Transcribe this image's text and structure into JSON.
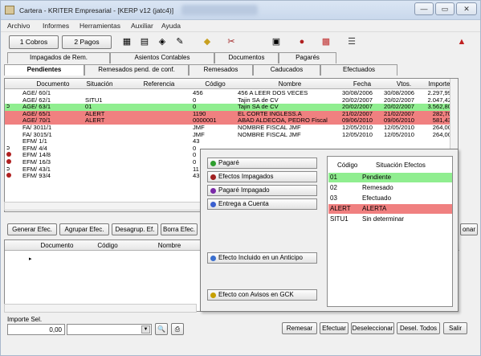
{
  "window": {
    "title": "Cartera - KRITER Empresarial - [KERP v12 (jatc4)]",
    "buttons": [
      "—",
      "▭",
      "✕"
    ]
  },
  "menu": [
    "Archivo",
    "Informes",
    "Herramientas",
    "Auxiliar",
    "Ayuda"
  ],
  "toolbar": {
    "cobros_label": "1 Cobros",
    "pagos_label": "2 Pagos"
  },
  "tabs_top": [
    "Impagados de Rem.",
    "Asientos Contables",
    "Documentos",
    "Pagarés"
  ],
  "tabs_bottom": [
    "Pendientes",
    "Remesados pend. de conf.",
    "Remesados",
    "Caducados",
    "Efectuados"
  ],
  "grid": {
    "columns": [
      "Documento",
      "Situación",
      "Referencia",
      "Código",
      "Nombre",
      "Fecha",
      "Vtos.",
      "Importe"
    ],
    "rows": [
      {
        "doc": "AGE/ 60/1",
        "sit": "",
        "ref": "",
        "cod": "456",
        "nom": "456 A LEER DOS VECES",
        "fecha": "30/08/2006",
        "vto": "30/08/2006",
        "imp": "2.297,99",
        "style": "",
        "mark": ""
      },
      {
        "doc": "AGE/ 62/1",
        "sit": "SITU1",
        "ref": "",
        "cod": "0",
        "nom": "Tajin SA de CV",
        "fecha": "20/02/2007",
        "vto": "20/02/2007",
        "imp": "2.047,42",
        "style": "",
        "mark": ""
      },
      {
        "doc": "AGE/ 63/1",
        "sit": "01",
        "ref": "",
        "cod": "0",
        "nom": "Tajin SA de CV",
        "fecha": "20/02/2007",
        "vto": "20/02/2007",
        "imp": "3.562,80",
        "style": "green",
        "mark": "arrow"
      },
      {
        "doc": "AGE/ 65/1",
        "sit": "ALERT",
        "ref": "",
        "cod": "1190",
        "nom": "EL CORTE INGLESS.A",
        "fecha": "21/02/2007",
        "vto": "21/02/2007",
        "imp": "282,70",
        "style": "red",
        "mark": ""
      },
      {
        "doc": "AGE/ 70/1",
        "sit": "ALERT",
        "ref": "",
        "cod": "0000001",
        "nom": "ABAD ALDECOA, PEDRO Fiscal",
        "fecha": "09/06/2010",
        "vto": "09/06/2010",
        "imp": "581,43",
        "style": "red",
        "mark": ""
      },
      {
        "doc": "FA/ 3011/1",
        "sit": "",
        "ref": "",
        "cod": "JMF",
        "nom": "NOMBRE FISCAL JMF",
        "fecha": "12/05/2010",
        "vto": "12/05/2010",
        "imp": "264,00",
        "style": "",
        "mark": ""
      },
      {
        "doc": "FA/ 3015/1",
        "sit": "",
        "ref": "",
        "cod": "JMF",
        "nom": "NOMBRE FISCAL JMF",
        "fecha": "12/05/2010",
        "vto": "12/05/2010",
        "imp": "264,00",
        "style": "",
        "mark": ""
      },
      {
        "doc": "EFM/ 1/1",
        "sit": "",
        "ref": "",
        "cod": "43",
        "nom": "",
        "fecha": "",
        "vto": "",
        "imp": "",
        "style": "",
        "mark": ""
      },
      {
        "doc": "EFM/ 4/4",
        "sit": "",
        "ref": "",
        "cod": "0",
        "nom": "",
        "fecha": "",
        "vto": "",
        "imp": "",
        "style": "",
        "mark": "arrow"
      },
      {
        "doc": "EFM/ 14/8",
        "sit": "",
        "ref": "",
        "cod": "0",
        "nom": "",
        "fecha": "",
        "vto": "",
        "imp": "",
        "style": "",
        "mark": "dot"
      },
      {
        "doc": "EFM/ 16/3",
        "sit": "",
        "ref": "",
        "cod": "0",
        "nom": "",
        "fecha": "",
        "vto": "",
        "imp": "",
        "style": "",
        "mark": "dot"
      },
      {
        "doc": "EFM/ 43/1",
        "sit": "",
        "ref": "",
        "cod": "11",
        "nom": "",
        "fecha": "",
        "vto": "",
        "imp": "",
        "style": "",
        "mark": "arrow"
      },
      {
        "doc": "EFM/ 93/4",
        "sit": "",
        "ref": "",
        "cod": "43",
        "nom": "",
        "fecha": "",
        "vto": "",
        "imp": "",
        "style": "",
        "mark": "dot"
      }
    ]
  },
  "actions": [
    "Generar Efec.",
    "Agrupar Efec.",
    "Desagrup. Ef.",
    "Borra Efec."
  ],
  "action_right": "onar",
  "lower_grid": {
    "columns": [
      "Documento",
      "Código",
      "Nombre"
    ]
  },
  "legend": {
    "buttons": [
      {
        "label": "Pagaré",
        "color": "#2e9e2e"
      },
      {
        "label": "Efectos Impagados",
        "color": "#a02020"
      },
      {
        "label": "Pagaré Impagado",
        "color": "#7a2aa8"
      },
      {
        "label": "Entrega a Cuenta",
        "color": "#3a5fcf"
      },
      {
        "label": "Efecto Incluido en un Anticipo",
        "color": "#3a6fcf"
      },
      {
        "label": "Efecto con Avisos en GCK",
        "color": "#c6a000"
      }
    ],
    "table_headers": [
      "Código",
      "Situación Efectos"
    ],
    "table_rows": [
      {
        "code": "01",
        "desc": "Pendiente",
        "color": "#90ee90"
      },
      {
        "code": "02",
        "desc": "Remesado",
        "color": ""
      },
      {
        "code": "03",
        "desc": "Efectuado",
        "color": ""
      },
      {
        "code": "ALERT",
        "desc": "ALERTA",
        "color": "#f08080"
      },
      {
        "code": "SITU1",
        "desc": "Sin determinar",
        "color": ""
      }
    ]
  },
  "bottom": {
    "importe_label": "Importe Sel.",
    "importe_value": "0,00",
    "buttons": [
      "Remesar",
      "Efectuar",
      "Deseleccionar",
      "Desel. Todos",
      "Salir"
    ]
  }
}
